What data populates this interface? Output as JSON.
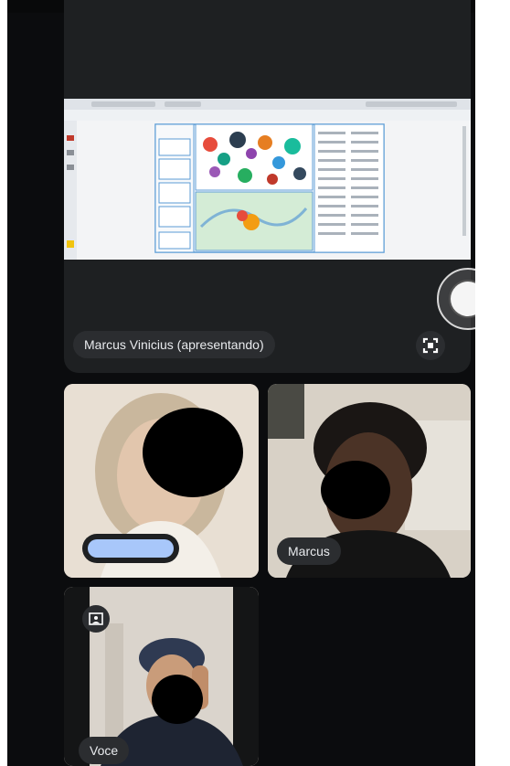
{
  "presenter_label": "Marcus Vinicius (apresentando)",
  "participants": [
    {
      "name": ""
    },
    {
      "name": "Marcus"
    },
    {
      "name": "Voce"
    }
  ],
  "colors": {
    "background": "#0b0c0e",
    "panel": "#1e2022",
    "pill": "#2b2d30",
    "highlight_pill": "#a8c7fa"
  },
  "icons": [
    "fullscreen-icon",
    "picture-in-picture-icon"
  ]
}
